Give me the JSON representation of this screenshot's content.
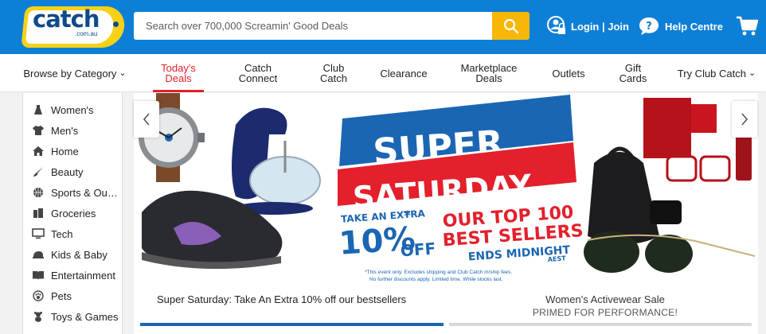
{
  "header": {
    "logo_text": "catch",
    "logo_sub": ".com.au",
    "search_placeholder": "Search over 700,000 Screamin' Good Deals",
    "login_label": "Login | Join",
    "help_label": "Help Centre",
    "icons": {
      "search": "search-icon",
      "login": "user-lock-icon",
      "help": "help-bubble-icon",
      "cart": "cart-icon"
    },
    "colors": {
      "bar": "#0e7fd6",
      "search_button": "#f8b707",
      "logo_yellow": "#f7d117"
    }
  },
  "nav": {
    "items": [
      {
        "label": "Browse by Category",
        "dropdown": true
      },
      {
        "line1": "Today's",
        "line2": "Deals",
        "active": true
      },
      {
        "line1": "Catch",
        "line2": "Connect"
      },
      {
        "line1": "Club",
        "line2": "Catch"
      },
      {
        "label": "Clearance"
      },
      {
        "line1": "Marketplace",
        "line2": "Deals"
      },
      {
        "label": "Outlets"
      },
      {
        "line1": "Gift",
        "line2": "Cards"
      },
      {
        "label": "Try Club Catch",
        "dropdown": true
      }
    ],
    "active_color": "#e3202c"
  },
  "sidebar": {
    "categories": [
      {
        "label": "Women's",
        "icon": "dress-icon"
      },
      {
        "label": "Men's",
        "icon": "tshirt-icon"
      },
      {
        "label": "Home",
        "icon": "house-icon"
      },
      {
        "label": "Beauty",
        "icon": "brush-icon"
      },
      {
        "label": "Sports & Outdoors",
        "icon": "basketball-icon"
      },
      {
        "label": "Groceries",
        "icon": "groceries-icon"
      },
      {
        "label": "Tech",
        "icon": "monitor-icon"
      },
      {
        "label": "Kids & Baby",
        "icon": "baby-icon"
      },
      {
        "label": "Entertainment",
        "icon": "book-icon"
      },
      {
        "label": "Pets",
        "icon": "paw-icon"
      },
      {
        "label": "Toys & Games",
        "icon": "teddy-icon"
      }
    ]
  },
  "carousel": {
    "banner": {
      "line1": "SUPER",
      "line2": "SATURDAY",
      "take_extra": "TAKE AN EXTRA",
      "pct": "10%",
      "star": "*",
      "off": "OFF",
      "our_top": "OUR TOP 100",
      "best_sellers": "BEST SELLERS",
      "ends": "ENDS MIDNIGHT",
      "aest": "AEST",
      "fine1": "*This event only. Excludes shipping and Club Catch m/ship fees.",
      "fine2": "No further discounts apply. Limited time. While stocks last.",
      "colors": {
        "blue": "#1b66b3",
        "red": "#e3202c"
      }
    },
    "slides": [
      {
        "caption": "Super Saturday: Take An Extra 10% off our bestsellers",
        "active": true
      },
      {
        "caption": "Women's Activewear Sale",
        "subcaption": "PRIMED FOR PERFORMANCE!",
        "active": false
      }
    ],
    "icons": {
      "prev": "chevron-left-icon",
      "next": "chevron-right-icon"
    }
  }
}
